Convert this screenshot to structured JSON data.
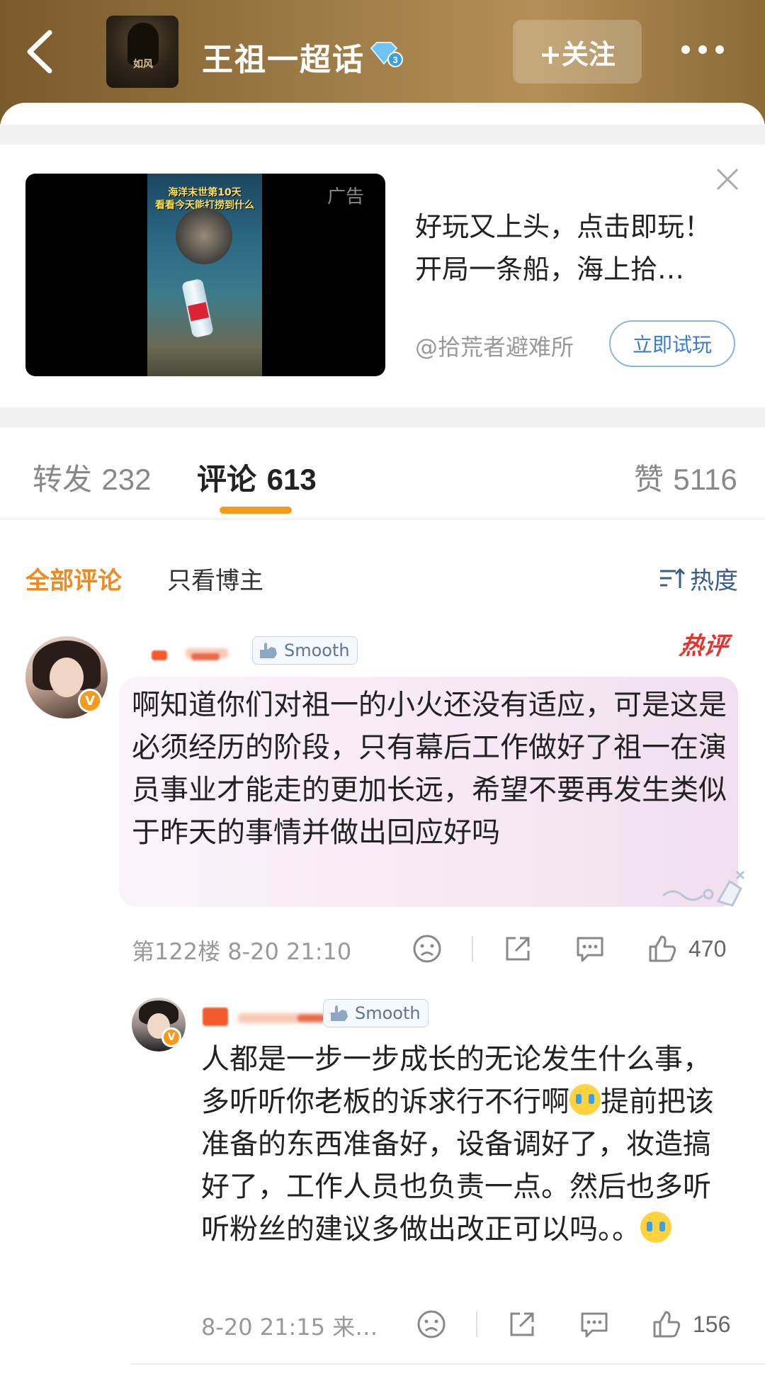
{
  "header": {
    "title": "王祖一超话",
    "follow_label": "+关注",
    "topic_avatar_caption": "如风"
  },
  "ad": {
    "tag": "广告",
    "video_caption": "海洋末世第10天\n看看今天能打捞到什么",
    "line1": "好玩又上头，点击即玩！",
    "line2": "开局一条船，海上拾…",
    "source": "@拾荒者避难所",
    "cta": "立即试玩"
  },
  "tabs": {
    "repost_label": "转发",
    "repost_count": "232",
    "comment_label": "评论",
    "comment_count": "613",
    "like_label": "赞",
    "like_count": "5116"
  },
  "filter": {
    "all": "全部评论",
    "op_only": "只看博主",
    "sort": "热度"
  },
  "comments": [
    {
      "badge": "Smooth",
      "hot": "热评",
      "text": "啊知道你们对祖一的小火还没有适应，可是这是必须经历的阶段，只有幕后工作做好了祖一在演员事业才能走的更加长远，希望不要再发生类似于昨天的事情并做出回应好吗",
      "meta": "第122楼 8-20 21:10",
      "likes": "470"
    }
  ],
  "reply": {
    "badge": "Smooth",
    "text_part1": "人都是一步一步成长的无论发生什么事，多听听你老板的诉求行不行啊",
    "text_part2": "提前把该准备的东西准备好，设备调好了，妆造搞好了，工作人员也负责一点。然后也多听听粉丝的建议多做出改正可以吗。。",
    "meta": "8-20 21:15 来…",
    "likes": "156"
  },
  "colors": {
    "accent_orange": "#f08a1c",
    "link_blue": "#3a7bd5",
    "hot_red": "#e8322c"
  }
}
